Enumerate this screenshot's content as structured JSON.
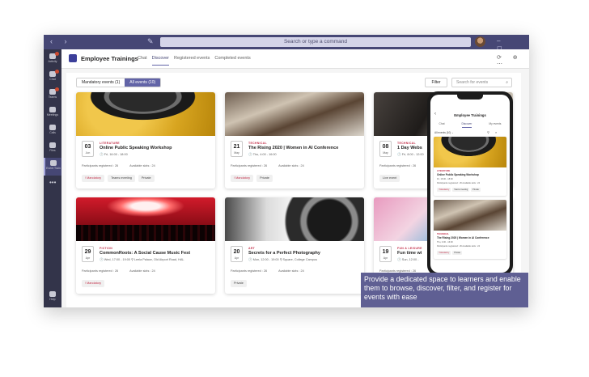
{
  "window": {
    "search_text": "Search or type a command",
    "nav_arrows": "‹ ›",
    "compose_glyph": "✎",
    "window_controls": "– ◻ ✕"
  },
  "rail": {
    "items": [
      {
        "label": "Activity",
        "icon": "bell-icon",
        "badge": true
      },
      {
        "label": "Chat",
        "icon": "chat-icon",
        "badge": true
      },
      {
        "label": "Teams",
        "icon": "teams-icon",
        "badge": true
      },
      {
        "label": "Meetings",
        "icon": "calendar-icon",
        "badge": false
      },
      {
        "label": "Calls",
        "icon": "phone-icon",
        "badge": false
      },
      {
        "label": "Files",
        "icon": "files-icon",
        "badge": false
      },
      {
        "label": "Event Train",
        "icon": "app-icon",
        "badge": false
      }
    ],
    "more": "•••",
    "help_label": "Help"
  },
  "app": {
    "title": "Employee Trainings",
    "tabs": [
      "Chat",
      "Discover",
      "Registered events",
      "Completed events"
    ],
    "active_tab": "Discover",
    "header_icons": "⟳ ⊕ ⋯"
  },
  "toolbar": {
    "segments": [
      "Mandatory events (1)",
      "All events (10)"
    ],
    "active_segment": "All events (10)",
    "filter_label": "Filter",
    "search_placeholder": "Search for events",
    "search_glyph": "⌕"
  },
  "events": [
    {
      "category": "LITERATURE",
      "title": "Online Public Speaking Workshop",
      "day": "03",
      "month": "Jun",
      "meta": "🕒 Fri, 16:00 - 18:00",
      "participants": "Participants registered : 26",
      "slots": "Available slots : 24",
      "tags": [
        "! Mandatory",
        "Teams meeting",
        "Private"
      ],
      "image": "microphone"
    },
    {
      "category": "TECHNICAL",
      "title": "The Rising 2020 | Women in AI Conference",
      "day": "21",
      "month": "May",
      "meta": "🕒 Thu, 4:00 - 16:00",
      "participants": "Participants registered : 26",
      "slots": "Available slots : 24",
      "tags": [
        "! Mandatory",
        "Private"
      ],
      "image": "conference"
    },
    {
      "category": "TECHNICAL",
      "title": "1 Day Webs",
      "day": "08",
      "month": "May",
      "meta": "🕒 Fri, 8:00 - 12:00",
      "participants": "Participants registered : 26",
      "slots": "",
      "tags": [
        "Live event"
      ],
      "image": "meeting"
    },
    {
      "category": "FICTION",
      "title": "CommonRoots: A Social Cause Music Fest",
      "day": "29",
      "month": "Apr",
      "meta": "🕒 Wed, 17:00 - 19:00  ⚲ Leela Palace, Old Airport Road, HAL",
      "participants": "Participants registered : 26",
      "slots": "Available slots : 24",
      "tags": [
        "! Mandatory"
      ],
      "image": "concert"
    },
    {
      "category": "ART",
      "title": "Secrets for a Perfect Photography",
      "day": "20",
      "month": "Apr",
      "meta": "🕒 Mon, 12:00 - 19:00  ⚲ Square, College Campus",
      "participants": "Participants registered : 26",
      "slots": "Available slots : 24",
      "tags": [
        "Private"
      ],
      "image": "camera-lens"
    },
    {
      "category": "FUN & LEISURE",
      "title": "Fun time wi",
      "day": "19",
      "month": "Apr",
      "meta": "🕒 Sun, 12:00 -",
      "participants": "Participants registered : 26",
      "slots": "",
      "tags": [],
      "image": "kids"
    }
  ],
  "phone": {
    "title": "Employee Trainings",
    "back": "‹",
    "tabs": [
      "Chat",
      "Discover",
      "My events"
    ],
    "active_tab": "Discover",
    "filter": "All events (10) ⌄",
    "filter_icons": "⚲ ⌕",
    "cards": [
      {
        "category": "LITERATURE",
        "title": "Online Public Speaking Workshop",
        "meta": "Fri, 16:00 - 18:00",
        "stats": "Participants registered : 26     Available slots : 24",
        "tags": [
          "! Mandatory",
          "Teams meeting",
          "Private"
        ]
      },
      {
        "category": "TECHNICAL",
        "title": "The Rising 2020 | Women in AI Conference",
        "meta": "Thu, 4:00 - 16:00",
        "stats": "Participants registered : 26     Available slots : 24",
        "tags": [
          "! Mandatory",
          "Private"
        ]
      }
    ]
  },
  "caption": "Provide a dedicated space to learners and enable them to browse, discover, filter, and register for events with ease"
}
